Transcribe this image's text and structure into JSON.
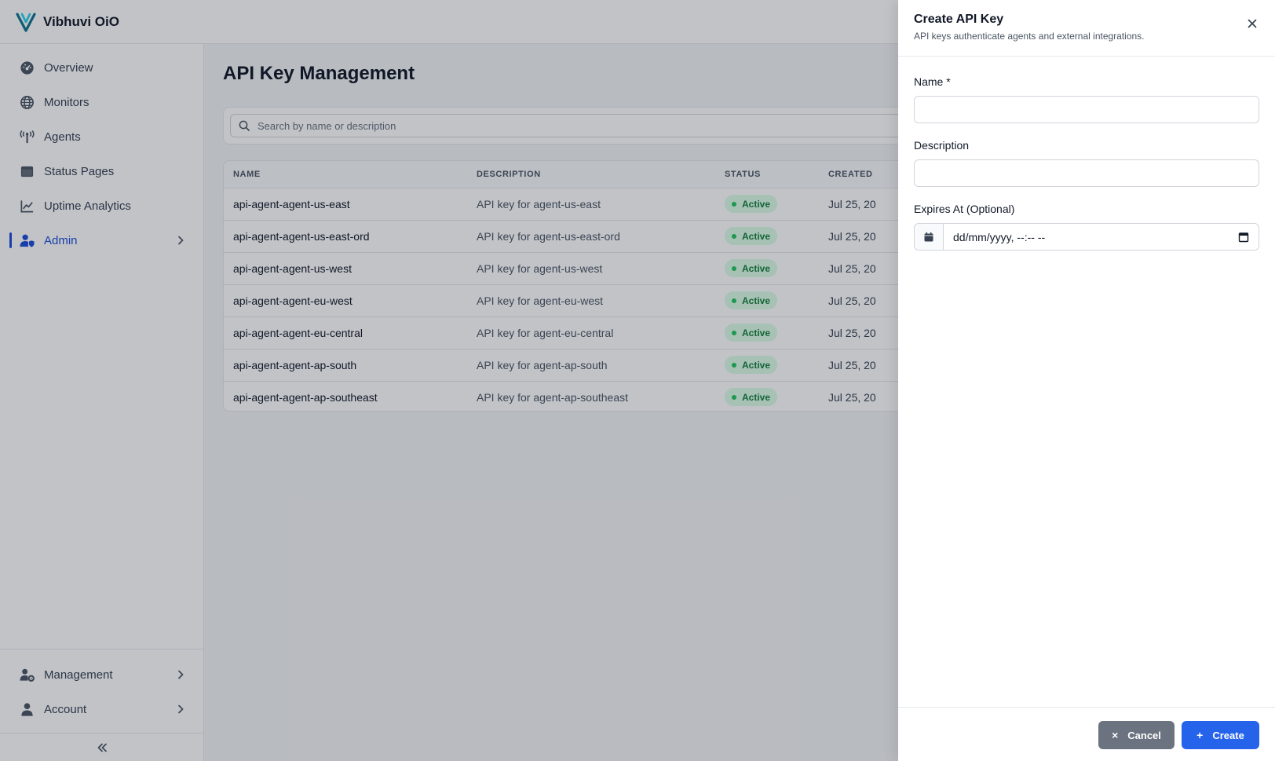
{
  "app": {
    "brand": "Vibhuvi OiO"
  },
  "sidebar": {
    "items": [
      {
        "label": "Overview",
        "icon": "dashboard-icon"
      },
      {
        "label": "Monitors",
        "icon": "globe-icon"
      },
      {
        "label": "Agents",
        "icon": "broadcast-tower-icon"
      },
      {
        "label": "Status Pages",
        "icon": "window-icon"
      },
      {
        "label": "Uptime Analytics",
        "icon": "line-chart-icon"
      },
      {
        "label": "Admin",
        "icon": "user-shield-icon",
        "active": true
      }
    ],
    "bottom": [
      {
        "label": "Management",
        "icon": "users-gear-icon"
      },
      {
        "label": "Account",
        "icon": "user-icon"
      }
    ]
  },
  "main": {
    "title": "API Key Management",
    "search_placeholder": "Search by name or description",
    "table": {
      "headers": [
        "NAME",
        "DESCRIPTION",
        "STATUS",
        "CREATED"
      ],
      "rows": [
        {
          "name": "api-agent-agent-us-east",
          "description": "API key for agent-us-east",
          "status": "Active",
          "created": "Jul 25, 20"
        },
        {
          "name": "api-agent-agent-us-east-ord",
          "description": "API key for agent-us-east-ord",
          "status": "Active",
          "created": "Jul 25, 20"
        },
        {
          "name": "api-agent-agent-us-west",
          "description": "API key for agent-us-west",
          "status": "Active",
          "created": "Jul 25, 20"
        },
        {
          "name": "api-agent-agent-eu-west",
          "description": "API key for agent-eu-west",
          "status": "Active",
          "created": "Jul 25, 20"
        },
        {
          "name": "api-agent-agent-eu-central",
          "description": "API key for agent-eu-central",
          "status": "Active",
          "created": "Jul 25, 20"
        },
        {
          "name": "api-agent-agent-ap-south",
          "description": "API key for agent-ap-south",
          "status": "Active",
          "created": "Jul 25, 20"
        },
        {
          "name": "api-agent-agent-ap-southeast",
          "description": "API key for agent-ap-southeast",
          "status": "Active",
          "created": "Jul 25, 20"
        }
      ]
    }
  },
  "drawer": {
    "title": "Create API Key",
    "subtitle": "API keys authenticate agents and external integrations.",
    "fields": {
      "name_label": "Name *",
      "name_value": "",
      "description_label": "Description",
      "description_value": "",
      "expires_label": "Expires At (Optional)",
      "expires_value": "dd/mm/yyyy, --:-- --"
    },
    "cancel_label": "Cancel",
    "create_label": "Create"
  },
  "colors": {
    "accent": "#2563eb",
    "active_nav": "#1d4ed8",
    "status_active_bg": "#dcfce7",
    "status_active_text": "#15803d",
    "cancel_button": "#6b7280"
  }
}
